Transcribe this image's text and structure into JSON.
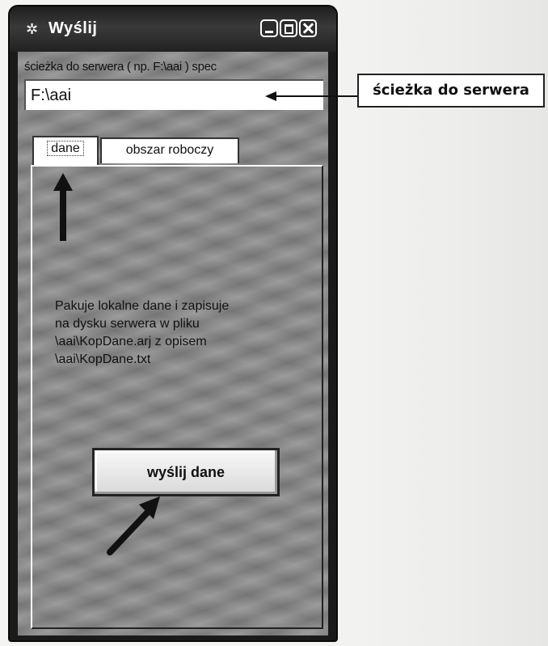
{
  "window": {
    "title": "Wyślij",
    "icon": "gear-icon",
    "controls": [
      "minimize-icon",
      "maximize-icon",
      "close-icon"
    ]
  },
  "path": {
    "label": "ścieżka do serwera ( np. F:\\aai )  spec",
    "value": "F:\\aai"
  },
  "tabs": [
    {
      "label": "dane",
      "active": true
    },
    {
      "label": "obszar roboczy",
      "active": false
    }
  ],
  "panel": {
    "description_lines": [
      "Pakuje lokalne dane i zapisuje",
      "na dysku serwera w pliku",
      "\\aai\\KopDane.arj z opisem",
      "\\aai\\KopDane.txt"
    ],
    "send_button_label": "wyślij dane"
  },
  "annotation": {
    "callout_label": "ścieżka do serwera"
  }
}
